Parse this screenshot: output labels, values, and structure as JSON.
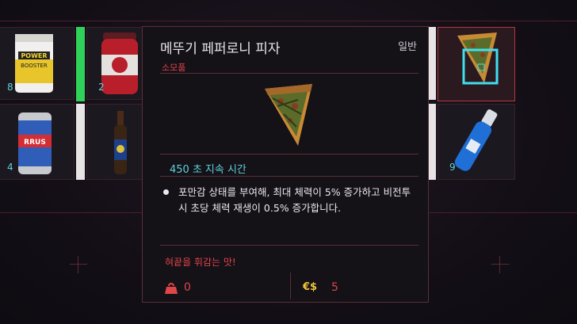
{
  "inventory": {
    "slots": [
      {
        "id": "power-booster",
        "count": "8",
        "icon": "power-booster-can-icon"
      },
      {
        "id": "red-protein-jar",
        "count": "2",
        "icon": "red-protein-jar-icon"
      },
      {
        "id": "soda-can",
        "count": "4",
        "icon": "soda-can-icon"
      },
      {
        "id": "hot-sauce-bottle",
        "count": "",
        "icon": "hot-sauce-bottle-icon"
      },
      {
        "id": "pizza-slice",
        "count": "",
        "icon": "pizza-slice-icon"
      },
      {
        "id": "inhaler",
        "count": "9",
        "icon": "inhaler-icon"
      }
    ]
  },
  "tooltip": {
    "title": "메뚜기 페퍼로니 피자",
    "rarity": "일반",
    "type": "소모품",
    "duration_value": "450 초",
    "duration_label": "지속 시간",
    "description": "포만감 상태를 부여해, 최대 체력이 5% 증가하고 비전투 시 초당 체력 재생이 0.5% 증가합니다.",
    "flavor": "혀끝을 휘감는 맛!",
    "weight": "0",
    "price_symbol": "€$",
    "price": "5"
  },
  "colors": {
    "accent_red": "#e0454a",
    "accent_cyan": "#5fd3da",
    "accent_green": "#2fd15a",
    "currency_yellow": "#f2c53b"
  }
}
